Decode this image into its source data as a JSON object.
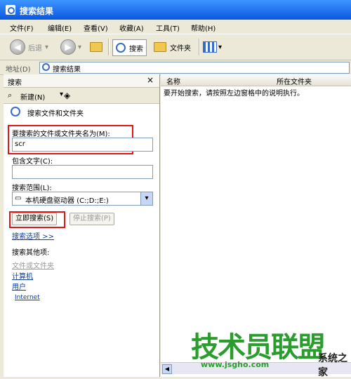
{
  "window": {
    "title": "搜索结果"
  },
  "menu": [
    {
      "label": "文件(F)"
    },
    {
      "label": "编辑(E)"
    },
    {
      "label": "查看(V)"
    },
    {
      "label": "收藏(A)"
    },
    {
      "label": "工具(T)"
    },
    {
      "label": "帮助(H)"
    }
  ],
  "toolbar": {
    "back": "后退",
    "search": "搜索",
    "folders": "文件夹"
  },
  "address": {
    "label": "地址(D)",
    "value": "搜索结果"
  },
  "panel": {
    "title": "搜索",
    "close": "×",
    "new": "新建(N)",
    "heading": "搜索文件和文件夹",
    "name_label": "要搜索的文件或文件夹名为(M):",
    "name_value": "scr",
    "text_label": "包含文字(C):",
    "text_value": "",
    "scope_label": "搜索范围(L):",
    "scope_value": "本机硬盘驱动器 (C:;D:;E:)",
    "search_button": "立即搜索(S)",
    "stop_button": "停止搜索(P)",
    "options": "搜索选项 >>",
    "other_label": "搜索其他项:",
    "other_items": [
      "文件或文件夹",
      "计算机",
      "用户"
    ],
    "internet": "Internet"
  },
  "results": {
    "columns": [
      "名称",
      "所在文件夹"
    ],
    "message": "要开始搜索，请按照左边窗格中的说明执行。"
  },
  "watermark": {
    "cn": "技术员联盟",
    "url": "www.jsgho.com",
    "corner": "系统之家"
  }
}
